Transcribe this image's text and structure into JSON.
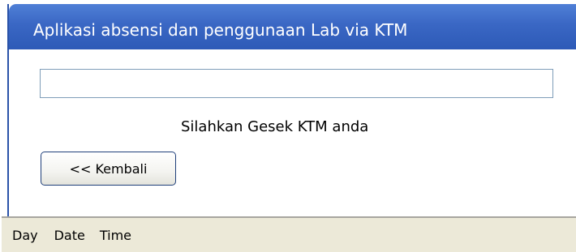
{
  "window": {
    "title": "Aplikasi absensi dan penggunaan Lab via KTM"
  },
  "main": {
    "ktm_input_value": "",
    "instruction": "Silahkan Gesek KTM anda",
    "back_button_label": "<< Kembali"
  },
  "statusbar": {
    "day": "Day",
    "date": "Date",
    "time": "Time"
  },
  "colors": {
    "titlebar": "#3a67c4",
    "title_text": "#ffffff",
    "statusbar_bg": "#ece9d8",
    "input_border": "#7f9db9",
    "button_border": "#1f3f7a"
  }
}
